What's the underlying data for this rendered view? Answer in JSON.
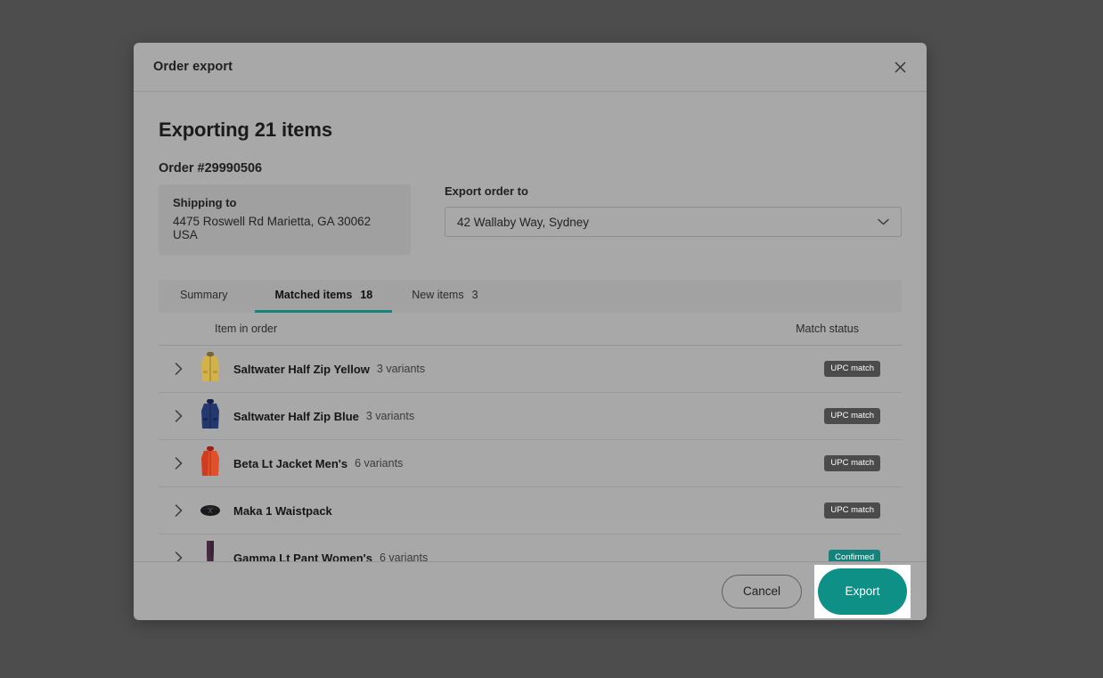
{
  "window": {
    "title": "Order export",
    "close_icon": "close-icon"
  },
  "main": {
    "headline": "Exporting 21 items",
    "order_number": "Order #29990506",
    "shipping": {
      "label": "Shipping to",
      "address": "4475 Roswell Rd Marietta, GA 30062 USA"
    },
    "export_to": {
      "label": "Export order to",
      "selected": "42 Wallaby Way, Sydney",
      "chevron_icon": "chevron-down-icon"
    }
  },
  "tabs": [
    {
      "label": "Summary",
      "count": "",
      "active": false
    },
    {
      "label": "Matched items",
      "count": "18",
      "active": true
    },
    {
      "label": "New items",
      "count": "3",
      "active": false
    }
  ],
  "table": {
    "columns": {
      "item": "Item in order",
      "status": "Match status"
    },
    "rows": [
      {
        "expand_icon": "chevron-right-icon",
        "thumb": "yellow-jacket-thumbnail",
        "name": "Saltwater Half Zip Yellow",
        "variants": "3 variants",
        "status": "UPC match",
        "status_type": "gray"
      },
      {
        "expand_icon": "chevron-right-icon",
        "thumb": "navy-jacket-thumbnail",
        "name": "Saltwater Half Zip Blue",
        "variants": "3 variants",
        "status": "UPC match",
        "status_type": "gray"
      },
      {
        "expand_icon": "chevron-right-icon",
        "thumb": "red-jacket-thumbnail",
        "name": "Beta Lt Jacket Men's",
        "variants": "6 variants",
        "status": "UPC match",
        "status_type": "gray"
      },
      {
        "expand_icon": "chevron-right-icon",
        "thumb": "black-waistpack-thumbnail",
        "name": "Maka 1 Waistpack",
        "variants": "",
        "status": "UPC match",
        "status_type": "gray"
      },
      {
        "expand_icon": "chevron-right-icon",
        "thumb": "purple-pants-thumbnail",
        "name": "Gamma Lt Pant Women's",
        "variants": "6 variants",
        "status": "Confirmed",
        "status_type": "teal"
      }
    ]
  },
  "footer": {
    "cancel_label": "Cancel",
    "export_label": "Export"
  },
  "colors": {
    "accent_teal": "#0f9087",
    "tab_underline": "#13837c",
    "badge_gray": "#4b4b4b",
    "badge_teal": "#13837c",
    "modal_bg": "#a8a8a8",
    "backdrop": "#4d4d4d"
  }
}
